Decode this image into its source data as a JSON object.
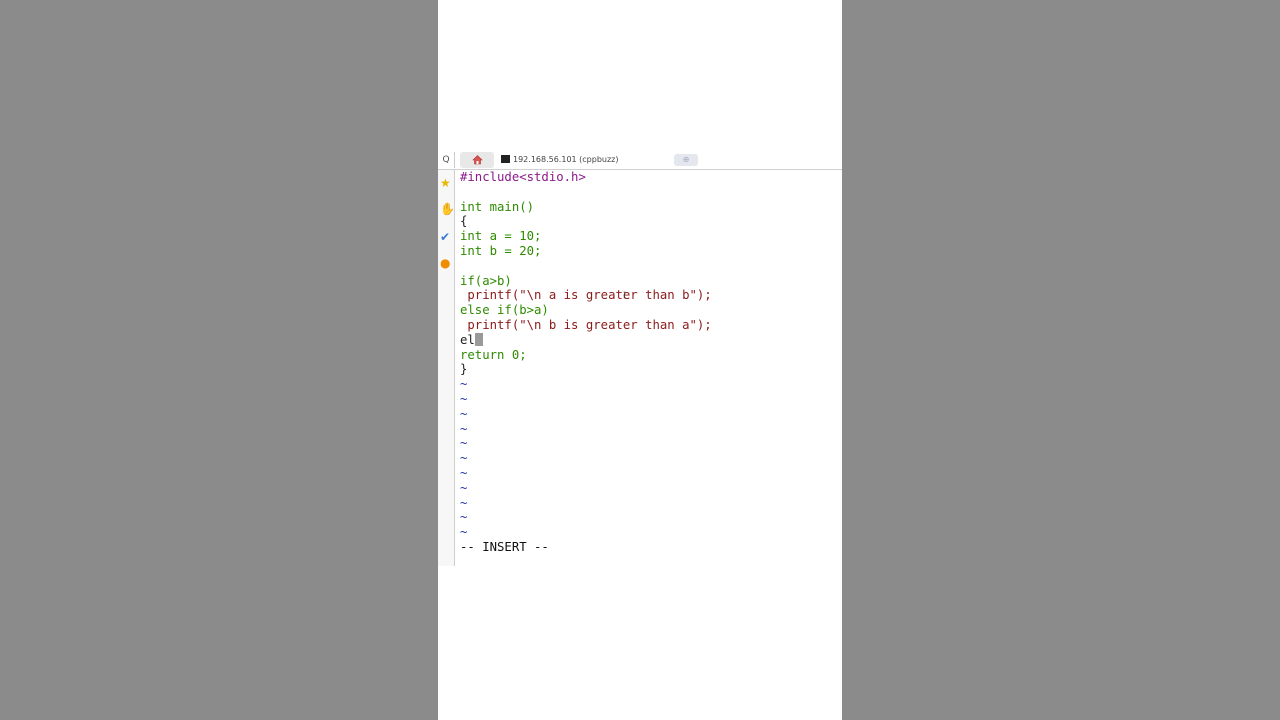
{
  "tab": {
    "search_icon": "Q",
    "home_icon": "home-icon",
    "title": "192.168.56.101 (cppbuzz)",
    "new_tab_icon": "new-tab-icon"
  },
  "sidebar": {
    "icons": [
      "star-icon",
      "hand-icon",
      "arrow-icon",
      "app-icon"
    ]
  },
  "editor": {
    "lines": [
      "#include<stdio.h>",
      "",
      "int main()",
      "{",
      "int a = 10;",
      "int b = 20;",
      "",
      "if(a>b)",
      " printf(\"\\n a is greater than b\");",
      "else if(b>a)",
      " printf(\"\\n b is greater than a\");",
      "el",
      "return 0;",
      "}"
    ],
    "tilde_count": 11,
    "tilde": "~",
    "mode_line": "-- INSERT --"
  },
  "colors": {
    "keyword": "#2e8b00",
    "preprocessor": "#8b1a8b",
    "string": "#8b1a1a",
    "tilde": "#2233aa"
  }
}
